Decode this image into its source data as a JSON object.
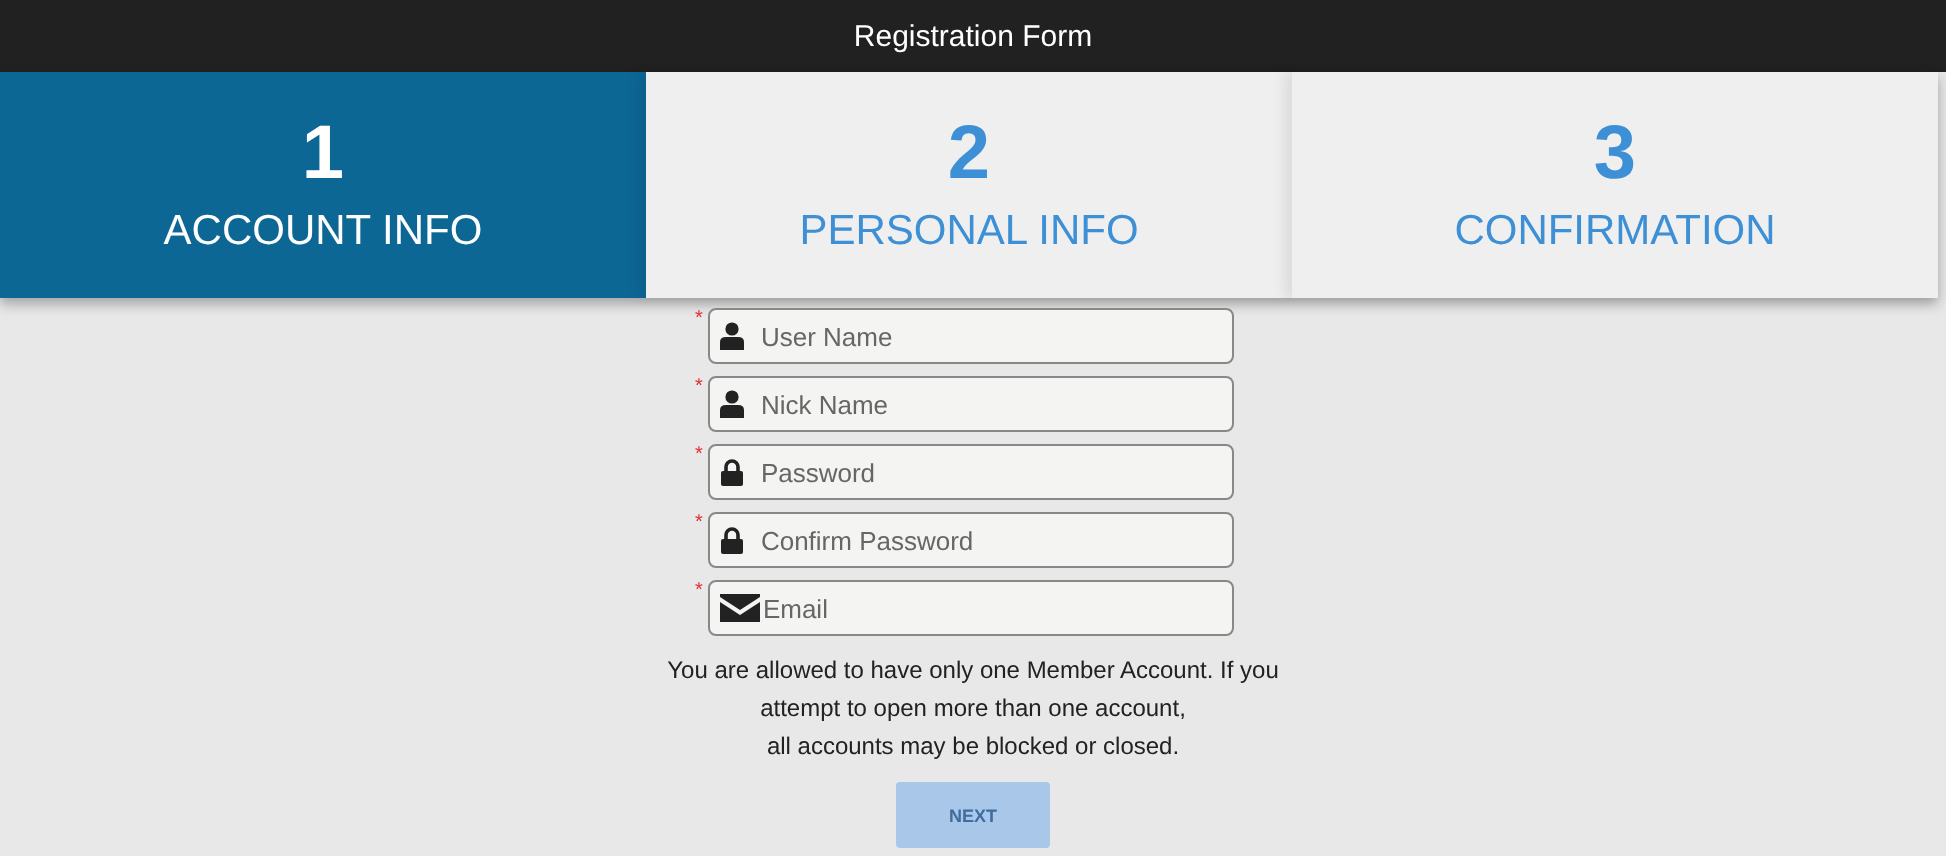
{
  "window": {
    "title": "Registration Form"
  },
  "steps": [
    {
      "number": "1",
      "label": "ACCOUNT INFO",
      "selected": true
    },
    {
      "number": "2",
      "label": "PERSONAL INFO",
      "selected": false
    },
    {
      "number": "3",
      "label": "CONFIRMATION",
      "selected": false
    }
  ],
  "fields": [
    {
      "mark": "*",
      "kind": "user",
      "placeholder": "User Name"
    },
    {
      "mark": "*",
      "kind": "user",
      "placeholder": "Nick Name"
    },
    {
      "mark": "*",
      "kind": "lock",
      "placeholder": "Password"
    },
    {
      "mark": "*",
      "kind": "lock",
      "placeholder": "Confirm Password"
    },
    {
      "mark": "*",
      "kind": "mail",
      "placeholder": "Email"
    }
  ],
  "notice": [
    "You are allowed to have only one Member Account. If you",
    "attempt to open more than one account,",
    "all accounts may be blocked or closed."
  ],
  "next_button": {
    "label": "NEXT",
    "disabled": true
  }
}
